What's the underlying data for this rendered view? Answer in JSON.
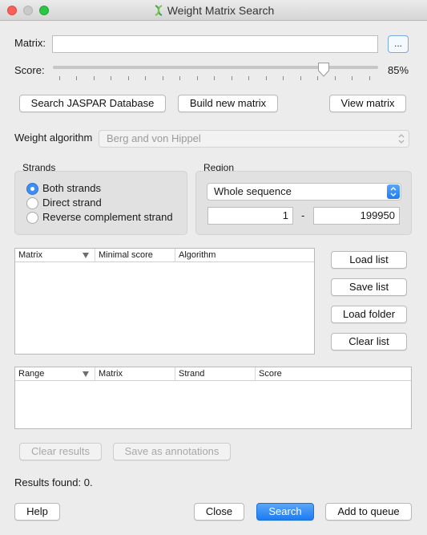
{
  "window": {
    "title": "Weight Matrix Search"
  },
  "matrix": {
    "label": "Matrix:",
    "value": "",
    "browse_label": "..."
  },
  "score": {
    "label": "Score:",
    "value_text": "85%",
    "value": 85
  },
  "top_buttons": {
    "search_jaspar": "Search JASPAR Database",
    "build_matrix": "Build new matrix",
    "view_matrix": "View matrix"
  },
  "weight_algorithm": {
    "label": "Weight algorithm",
    "selected": "Berg and von Hippel"
  },
  "strands": {
    "title": "Strands",
    "options": [
      {
        "label": "Both strands",
        "checked": true
      },
      {
        "label": "Direct strand",
        "checked": false
      },
      {
        "label": "Reverse complement strand",
        "checked": false
      }
    ]
  },
  "region": {
    "title": "Region",
    "selected": "Whole sequence",
    "start": "1",
    "separator": "-",
    "end": "199950"
  },
  "matrix_table": {
    "columns": [
      "Matrix",
      "Minimal score",
      "Algorithm"
    ],
    "rows": []
  },
  "list_buttons": {
    "load_list": "Load list",
    "save_list": "Save list",
    "load_folder": "Load folder",
    "clear_list": "Clear list"
  },
  "results_table": {
    "columns": [
      "Range",
      "Matrix",
      "Strand",
      "Score"
    ],
    "rows": []
  },
  "result_actions": {
    "clear_results": "Clear results",
    "save_annotations": "Save as annotations"
  },
  "status": {
    "results_found": "Results found: 0."
  },
  "footer": {
    "help": "Help",
    "close": "Close",
    "search": "Search",
    "add_to_queue": "Add to queue"
  },
  "colors": {
    "accent": "#1d7cf2",
    "close_light": "#fc5f57",
    "zoom_light": "#2ac840"
  }
}
